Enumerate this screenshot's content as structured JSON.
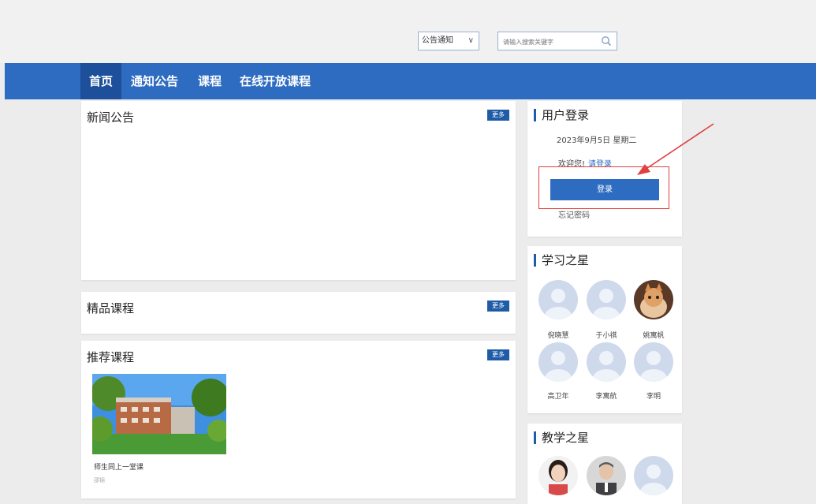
{
  "search": {
    "category_value": "公告通知",
    "placeholder": "请输入搜索关键字"
  },
  "nav": {
    "items": [
      {
        "label": "首页"
      },
      {
        "label": "通知公告"
      },
      {
        "label": "课程"
      },
      {
        "label": "在线开放课程"
      }
    ]
  },
  "more_label": "更多",
  "news": {
    "title": "新闻公告"
  },
  "featured": {
    "title": "精品课程"
  },
  "recommended": {
    "title": "推荐课程",
    "courses": [
      {
        "name": "师生同上一堂课",
        "sub": "邵锦"
      }
    ]
  },
  "login": {
    "title": "用户登录",
    "date": "2023年9月5日 星期二",
    "welcome": "欢迎您!",
    "login_link": "请登录",
    "button": "登录",
    "forgot": "忘记密码"
  },
  "study_stars": {
    "title": "学习之星",
    "people": [
      {
        "name": "倪晓慧",
        "avatar": "default-avatar"
      },
      {
        "name": "于小祺",
        "avatar": "default-avatar"
      },
      {
        "name": "姚寓帆",
        "avatar": "cat-photo"
      },
      {
        "name": "高卫年",
        "avatar": "default-avatar"
      },
      {
        "name": "李寓航",
        "avatar": "default-avatar"
      },
      {
        "name": "李明",
        "avatar": "default-avatar"
      }
    ]
  },
  "teach_stars": {
    "title": "教学之星",
    "people": [
      {
        "avatar": "woman-photo"
      },
      {
        "avatar": "man-photo"
      },
      {
        "avatar": "default-avatar"
      }
    ]
  },
  "colors": {
    "nav_blue": "#2e6cc1",
    "nav_active": "#1e4f9a",
    "more_blue": "#1f5ca8",
    "annotation_red": "#e04040"
  }
}
